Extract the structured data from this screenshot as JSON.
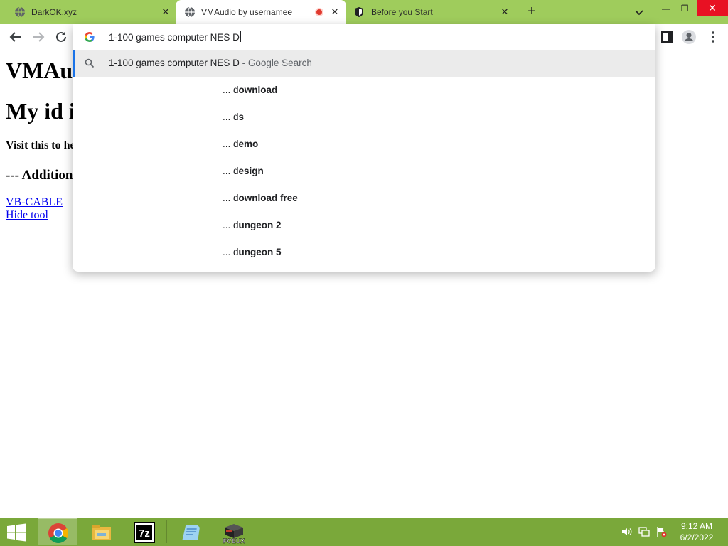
{
  "tabs": [
    {
      "title": "DarkOK.xyz",
      "icon": "globe-icon"
    },
    {
      "title": "VMAudio by usernamee",
      "icon": "globe-icon",
      "recording": true
    },
    {
      "title": "Before you Start",
      "icon": "shield-icon"
    }
  ],
  "tab_close_glyph": "✕",
  "new_tab_glyph": "+",
  "window_controls": {
    "minimize": "—",
    "maximize": "❐",
    "close": "✕"
  },
  "omnibox": {
    "query": "1-100 games computer NES D",
    "first_suggestion": {
      "text": "1-100 games computer NES D",
      "suffix": " - Google Search"
    },
    "suggestions": [
      {
        "prefix": "... d",
        "completion": "ownload"
      },
      {
        "prefix": "... d",
        "completion": "s"
      },
      {
        "prefix": "... d",
        "completion": "emo"
      },
      {
        "prefix": "... d",
        "completion": "esign"
      },
      {
        "prefix": "... d",
        "completion": "ownload free"
      },
      {
        "prefix": "... d",
        "completion": "ungeon 2"
      },
      {
        "prefix": "... d",
        "completion": "ungeon 5"
      }
    ]
  },
  "page": {
    "heading_1": "VMAu",
    "heading_2": "My id i",
    "visit_text": "Visit this to he",
    "additional_heading": "--- Addition",
    "link_vbcable": "VB-CABLE",
    "link_hide_tool": "Hide tool"
  },
  "taskbar": {
    "apps": [
      "chrome-icon",
      "file-explorer-icon",
      "7zip-icon",
      "notepad-icon",
      "fceux-icon"
    ],
    "app_7z_label": "7z",
    "app_fceux_label": "FCEUX",
    "time": "9:12 AM",
    "date": "6/2/2022"
  },
  "colors": {
    "tabstrip": "#9fcc5c",
    "taskbar": "#7aa83a",
    "link": "#0000ee",
    "omnibox_highlight": "#ebebeb",
    "focus_accent": "#1a73e8",
    "recording_dot": "#e03a2f"
  }
}
